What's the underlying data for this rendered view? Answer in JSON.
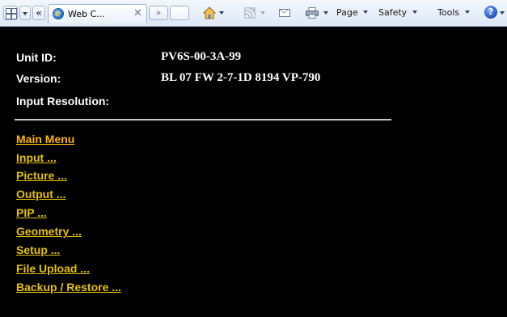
{
  "toolbar": {
    "tab_title": "Web C...",
    "tab_close": "✕",
    "back_label": "«",
    "more_tabs": "»",
    "page_menu": "Page",
    "safety_menu": "Safety",
    "tools_menu": "Tools",
    "help_glyph": "?"
  },
  "info": {
    "unit_id_label": "Unit ID:",
    "unit_id_value": "PV6S-00-3A-99",
    "version_label": "Version:",
    "version_value": "BL 07 FW 2-7-1D 8194 VP-790",
    "input_resolution_label": "Input Resolution:",
    "input_resolution_value": ""
  },
  "nav": [
    {
      "label": "Main Menu"
    },
    {
      "label": "Input ..."
    },
    {
      "label": "Picture ..."
    },
    {
      "label": "Output ..."
    },
    {
      "label": "PIP ..."
    },
    {
      "label": "Geometry ..."
    },
    {
      "label": "Setup ..."
    },
    {
      "label": "File Upload ..."
    },
    {
      "label": "Backup / Restore ..."
    }
  ],
  "colors": {
    "background": "#000000",
    "text": "#ffffff",
    "link": "#e6c200",
    "link_active": "#ffb400",
    "divider": "#c8c8c8"
  }
}
